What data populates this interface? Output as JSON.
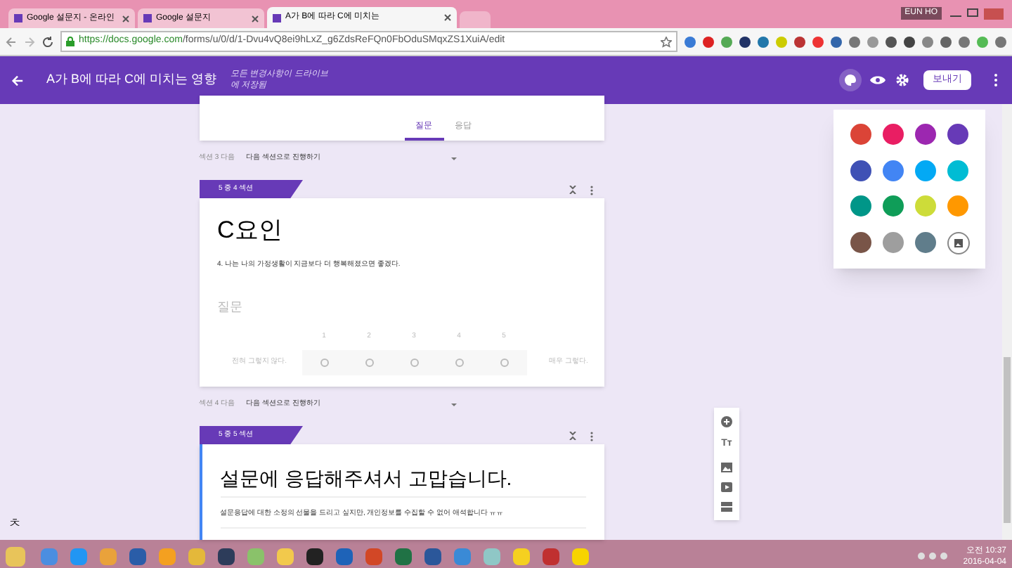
{
  "browser": {
    "tabs": [
      {
        "title": "Google 설문지 - 온라인",
        "selected": false
      },
      {
        "title": "Google 설문지",
        "selected": false
      },
      {
        "title": "A가 B에 따라 C에 미치는",
        "selected": true
      }
    ],
    "user": "EUN HO",
    "url_host": "https://docs.google.com",
    "url_path": "/forms/u/0/d/1-Dvu4vQ8ei9hLxZ_g6ZdsReFQn0FbOduSMqxZS1XuiA/edit"
  },
  "header": {
    "title": "A가 B에 따라 C에 미치는 영향",
    "save_status": "모든 변경사항이 드라이브에 저장됨",
    "send_button": "보내기"
  },
  "form_tabs": [
    {
      "label": "질문",
      "selected": true
    },
    {
      "label": "응답",
      "selected": false
    }
  ],
  "sections": [
    {
      "after_label": "섹션 3 다음",
      "after_action": "다음 섹션으로 진행하기"
    },
    {
      "badge": "5 중 4 섹션",
      "title": "C요인",
      "description": "4. 나는 나의 가정생활이 지금보다 더 행복해졌으면 좋겠다.",
      "question": {
        "placeholder": "질문",
        "scale": [
          "1",
          "2",
          "3",
          "4",
          "5"
        ],
        "low_label": "전혀 그렇지 않다.",
        "high_label": "매우 그렇다."
      },
      "focused": false,
      "after_label": "섹션 4 다음",
      "after_action": "다음 섹션으로 진행하기"
    },
    {
      "badge": "5 중 5 섹션",
      "title": "설문에 응답해주셔서 고맙습니다.",
      "description": "설문응답에 대한 소정의 선물을 드리고 싶지만, 개인정보를 수집할 수 없어 애석합니다 ㅠㅠ",
      "focused": true
    }
  ],
  "theme_colors": [
    {
      "color": "#db4437"
    },
    {
      "color": "#e91e63"
    },
    {
      "color": "#9c27b0"
    },
    {
      "color": "#673ab7"
    },
    {
      "color": "#3f51b5"
    },
    {
      "color": "#4285f4"
    },
    {
      "color": "#03a9f4"
    },
    {
      "color": "#00bcd4"
    },
    {
      "color": "#009688"
    },
    {
      "color": "#0f9d58"
    },
    {
      "color": "#cddc39"
    },
    {
      "color": "#ff9800"
    },
    {
      "color": "#795548"
    },
    {
      "color": "#9e9e9e"
    },
    {
      "color": "#607d8b"
    }
  ],
  "side_toolbar": {
    "title_button": "Tт"
  },
  "ime_indicator": "ㅊ",
  "taskbar": {
    "time": "오전 10:37",
    "date": "2016-04-04"
  }
}
